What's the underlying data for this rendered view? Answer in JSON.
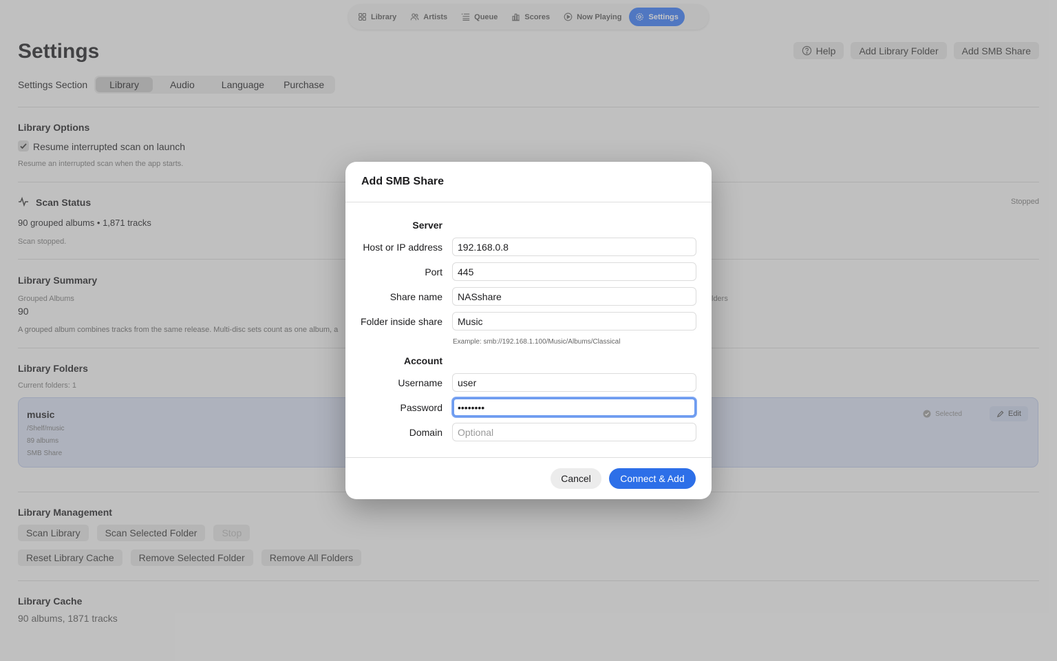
{
  "nav": {
    "items": [
      {
        "label": "Library",
        "icon": "grid-icon"
      },
      {
        "label": "Artists",
        "icon": "people-icon"
      },
      {
        "label": "Queue",
        "icon": "list-icon"
      },
      {
        "label": "Scores",
        "icon": "chart-icon"
      },
      {
        "label": "Now Playing",
        "icon": "play-circle-icon"
      },
      {
        "label": "Settings",
        "icon": "gear-icon"
      }
    ],
    "active": "Settings"
  },
  "header": {
    "title": "Settings",
    "help": "Help",
    "add_folder": "Add Library Folder",
    "add_smb": "Add SMB Share"
  },
  "section_picker": {
    "label": "Settings Section",
    "tabs": [
      "Library",
      "Audio",
      "Language",
      "Purchase"
    ],
    "selected": "Library"
  },
  "library_options": {
    "title": "Library Options",
    "resume_label": "Resume interrupted scan on launch",
    "resume_checked": true,
    "resume_desc": "Resume an interrupted scan when the app starts."
  },
  "scan_status": {
    "title": "Scan Status",
    "summary": "90 grouped albums • 1,871 tracks",
    "detail": "Scan stopped.",
    "state": "Stopped"
  },
  "library_summary": {
    "title": "Library Summary",
    "grouped_label": "Grouped Albums",
    "grouped_value": "90",
    "desc": "A grouped album combines tracks from the same release. Multi-disc sets count as one album, a",
    "right_fragment": "lders"
  },
  "library_folders": {
    "title": "Library Folders",
    "count": "Current folders: 1",
    "folder": {
      "name": "music",
      "path": "/Shelf/music",
      "albums": "89 albums",
      "type": "SMB Share",
      "selected_label": "Selected",
      "edit_label": "Edit"
    }
  },
  "library_management": {
    "title": "Library Management",
    "row1": [
      "Scan Library",
      "Scan Selected Folder",
      "Stop"
    ],
    "row2": [
      "Reset Library Cache",
      "Remove Selected Folder",
      "Remove All Folders"
    ]
  },
  "library_cache": {
    "title": "Library Cache",
    "value": "90 albums, 1871 tracks"
  },
  "dialog": {
    "title": "Add SMB Share",
    "server_heading": "Server",
    "host_label": "Host or IP address",
    "host_value": "192.168.0.8",
    "port_label": "Port",
    "port_value": "445",
    "share_label": "Share name",
    "share_value": "NASshare",
    "folder_label": "Folder inside share",
    "folder_value": "Music",
    "example": "Example: smb://192.168.1.100/Music/Albums/Classical",
    "account_heading": "Account",
    "username_label": "Username",
    "username_value": "user",
    "password_label": "Password",
    "password_value": "password",
    "domain_label": "Domain",
    "domain_placeholder": "Optional",
    "cancel": "Cancel",
    "connect": "Connect & Add"
  },
  "colors": {
    "accent": "#3478f6",
    "primary_button": "#2d6fe8",
    "focus_ring": "#6e9cf0"
  }
}
